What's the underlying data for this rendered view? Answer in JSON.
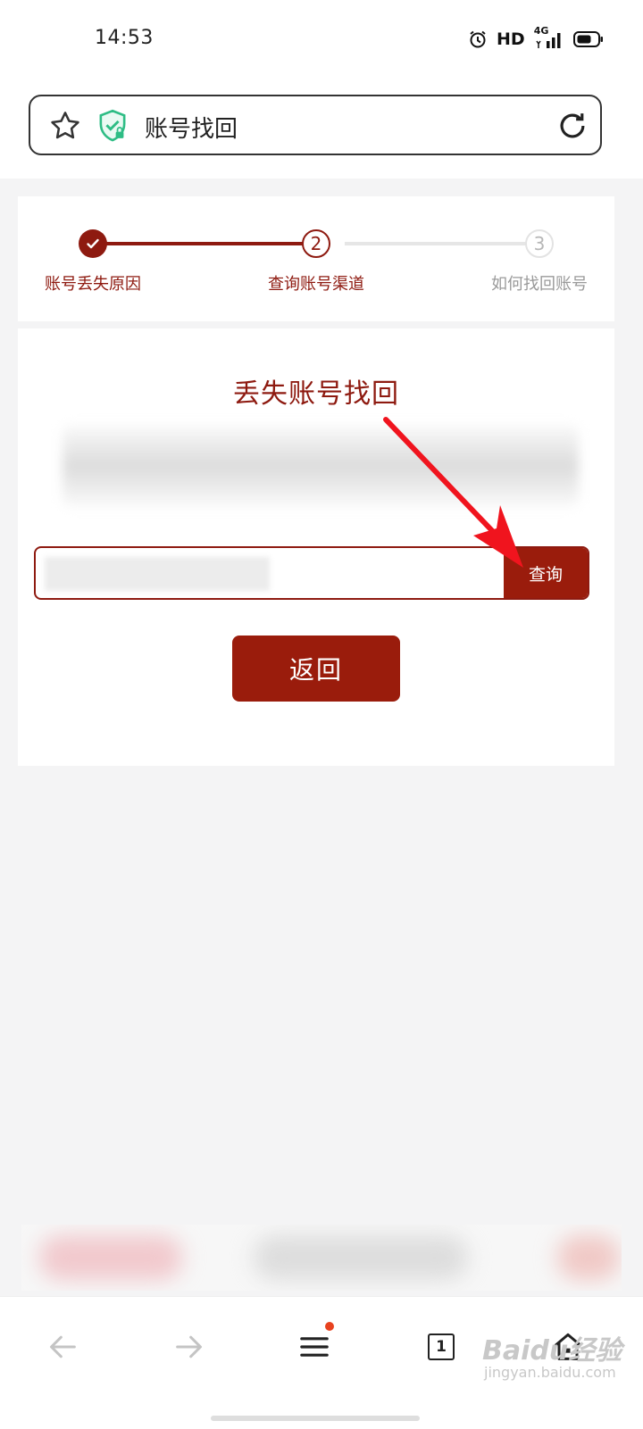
{
  "status_bar": {
    "time": "14:53",
    "hd": "HD",
    "network": "4G",
    "icons": [
      "alarm-icon",
      "signal-icon",
      "battery-icon"
    ]
  },
  "address_bar": {
    "title": "账号找回",
    "icons": [
      "star-icon",
      "shield-check-icon",
      "reload-icon"
    ]
  },
  "steps": [
    {
      "number": "1",
      "label": "账号丢失原因",
      "state": "done"
    },
    {
      "number": "2",
      "label": "查询账号渠道",
      "state": "current"
    },
    {
      "number": "3",
      "label": "如何找回账号",
      "state": "pending"
    }
  ],
  "main": {
    "title": "丢失账号找回",
    "search_value": "",
    "search_button": "查询",
    "back_button": "返回"
  },
  "bottom_nav": {
    "tab_count": "1",
    "icons": [
      "back-arrow-icon",
      "forward-arrow-icon",
      "menu-icon",
      "tabs-icon",
      "home-icon"
    ]
  },
  "watermark": {
    "text": "Baidu经验",
    "sub": "jingyan.baidu.com"
  },
  "colors": {
    "accent": "#9a1c0c",
    "accent_dark": "#8e1a10",
    "background": "#f4f4f5",
    "annotation_arrow": "#f0141e"
  }
}
